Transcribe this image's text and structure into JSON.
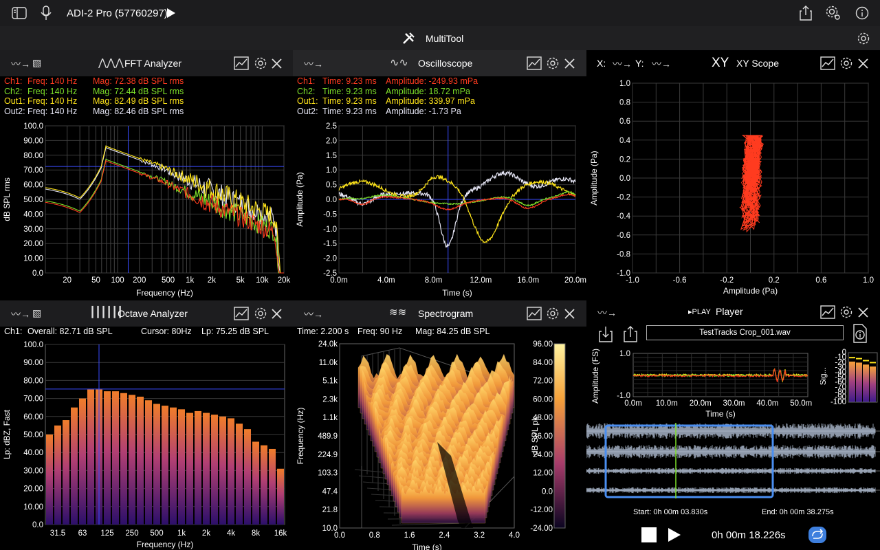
{
  "app": {
    "device": "ADI-2 Pro (57760297)",
    "title": "MultiTool"
  },
  "colors": {
    "ch1": "#ff3b1f",
    "ch2": "#7ee02a",
    "out1": "#ffe51a",
    "out2": "#e6e6f5",
    "marker": "#3a4cff"
  },
  "fft": {
    "title": "FFT Analyzer",
    "readout": [
      {
        "ch": "Ch1:",
        "freq": "Freq: 140 Hz",
        "mag": "Mag: 72.38 dB SPL rms"
      },
      {
        "ch": "Ch2:",
        "freq": "Freq: 140 Hz",
        "mag": "Mag: 72.44 dB SPL rms"
      },
      {
        "ch": "Out1:",
        "freq": "Freq: 140 Hz",
        "mag": "Mag: 82.49 dB SPL rms"
      },
      {
        "ch": "Out2:",
        "freq": "Freq: 140 Hz",
        "mag": "Mag: 82.46 dB SPL rms"
      }
    ],
    "yticks": [
      "100.0",
      "90.00",
      "80.00",
      "70.00",
      "60.00",
      "50.00",
      "40.00",
      "30.00",
      "20.00",
      "10.00",
      "0.0"
    ],
    "xticks": [
      "20",
      "50",
      "100",
      "200",
      "500",
      "1k",
      "2k",
      "5k",
      "10k",
      "20k"
    ],
    "xlabel": "Frequency (Hz)",
    "ylabel": "dB SPL rms"
  },
  "osc": {
    "title": "Oscilloscope",
    "readout": [
      {
        "ch": "Ch1:",
        "time": "Time: 9.23 ms",
        "amp": "Amplitude: -249.93 mPa"
      },
      {
        "ch": "Ch2:",
        "time": "Time: 9.23 ms",
        "amp": "Amplitude: 18.72 mPa"
      },
      {
        "ch": "Out1:",
        "time": "Time: 9.23 ms",
        "amp": "Amplitude: 339.97 mPa"
      },
      {
        "ch": "Out2:",
        "time": "Time: 9.23 ms",
        "amp": "Amplitude: -1.73 Pa"
      }
    ],
    "yticks": [
      "2.5",
      "2.0",
      "1.5",
      "1.0",
      "0.5",
      "0.0",
      "-0.5",
      "-1.0",
      "-1.5",
      "-2.0",
      "-2.5"
    ],
    "xticks": [
      "0.0m",
      "4.0m",
      "8.0m",
      "12.0m",
      "16.0m",
      "20.0m"
    ],
    "xlabel": "Time (s)",
    "ylabel": "Amplitude (Pa)"
  },
  "xy": {
    "title": "XY Scope",
    "x_label": "X:",
    "y_label": "Y:",
    "logo": "XY",
    "yticks": [
      "1.0",
      "0.8",
      "0.6",
      "0.4",
      "0.2",
      "0.0",
      "-0.2",
      "-0.4",
      "-0.6",
      "-0.8",
      "-1.0"
    ],
    "xticks": [
      "-1.0",
      "-0.6",
      "-0.2",
      "0.2",
      "0.6",
      "1.0"
    ],
    "xlabel": "Amplitude (Pa)",
    "ylabel": "Amplitude (Pa)"
  },
  "octave": {
    "title": "Octave Analyzer",
    "readout": {
      "ch": "Ch1:",
      "overall": "Overall: 82.71 dB SPL",
      "cursor": "Cursor: 80Hz",
      "lp": "Lp: 75.25 dB SPL"
    },
    "yticks": [
      "100.0",
      "90.00",
      "80.00",
      "70.00",
      "60.00",
      "50.00",
      "40.00",
      "30.00",
      "20.00",
      "10.00",
      "0.0"
    ],
    "xticks": [
      "31.5",
      "63",
      "125",
      "250",
      "500",
      "1k",
      "2k",
      "4k",
      "8k",
      "16k"
    ],
    "xlabel": "Frequency (Hz)",
    "ylabel": "Lp: dBZ, Fast",
    "bands": [
      50,
      55,
      58,
      65,
      70,
      75,
      75,
      74,
      74,
      73,
      72,
      71,
      69,
      67,
      66,
      65,
      64,
      62,
      63,
      62,
      61,
      60,
      59,
      56,
      53,
      46,
      44,
      42,
      31
    ]
  },
  "spectro": {
    "title": "Spectrogram",
    "readout": {
      "time": "Time: 2.200 s",
      "freq": "Freq: 90 Hz",
      "mag": "Mag: 84.25 dB SPL"
    },
    "yticks": [
      "24.0k",
      "11.0k",
      "5.1k",
      "2.3k",
      "1.1k",
      "489.9",
      "224.9",
      "103.3",
      "47.4",
      "21.8",
      "10.0"
    ],
    "xticks": [
      "0.0",
      "0.8",
      "1.6",
      "2.4",
      "3.2",
      "4.0"
    ],
    "xlabel": "Time (s)",
    "ylabel": "Frequency (Hz)",
    "cbar_ticks": [
      "96.00",
      "84.00",
      "72.00",
      "60.00",
      "48.00",
      "36.00",
      "24.00",
      "12.00",
      "0.0",
      "-12.00",
      "-24.00"
    ],
    "cbar_label": "dB SPL pk"
  },
  "player": {
    "title": "Player",
    "badge": "▸PLAY",
    "file": "TestTracks Crop_001.wav",
    "mini_yticks": [
      "1.0",
      "-1.0"
    ],
    "mini_xticks": [
      "0.0m",
      "10.0m",
      "20.0m",
      "30.0m",
      "40.0m",
      "50.0m"
    ],
    "mini_xlabel": "Time (s)",
    "mini_ylabel": "Amplitude (FS)",
    "meter_ticks": [
      "0",
      "-10",
      "-20",
      "-30",
      "-40",
      "-50",
      "-60",
      "-70",
      "-80",
      "-90",
      "-100"
    ],
    "meter_label": "Sig...",
    "start": "Start: 0h 00m 03.830s",
    "end": "End: 0h 00m 38.275s",
    "time": "0h 00m 18.226s"
  }
}
